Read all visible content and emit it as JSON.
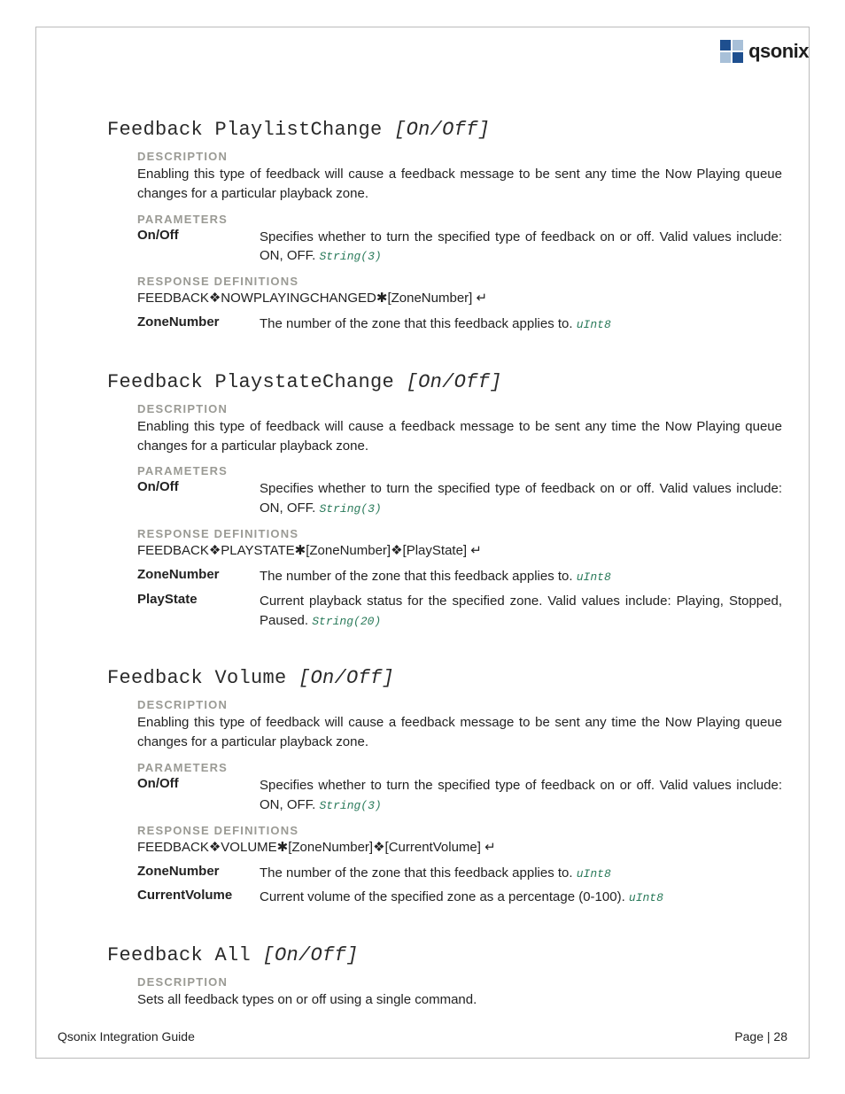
{
  "brand": "qsonix",
  "footer": {
    "left": "Qsonix Integration Guide",
    "right": "Page | 28"
  },
  "labels": {
    "description": "DESCRIPTION",
    "parameters": "PARAMETERS",
    "response_definitions": "RESPONSE DEFINITIONS"
  },
  "sections": [
    {
      "title_cmd": "Feedback PlaylistChange",
      "title_arg": "[On/Off]",
      "description": "Enabling this type of feedback will cause a feedback message to be sent any time the Now Playing queue changes for a particular playback zone.",
      "parameters": [
        {
          "name": "On/Off",
          "desc": "Specifies whether to turn the specified type of feedback on or off.  Valid values include:  ON, OFF.",
          "type": "String(3)"
        }
      ],
      "response": "FEEDBACK❖NOWPLAYINGCHANGED✱[ZoneNumber] ↵",
      "response_params": [
        {
          "name": "ZoneNumber",
          "desc": "The number of the zone that this feedback applies to.",
          "type": "uInt8"
        }
      ]
    },
    {
      "title_cmd": "Feedback PlaystateChange",
      "title_arg": "[On/Off]",
      "description": "Enabling this type of feedback will cause a feedback message to be sent any time the Now Playing queue changes for a particular playback zone.",
      "parameters": [
        {
          "name": "On/Off",
          "desc": "Specifies whether to turn the specified type of feedback on or off.  Valid values include:  ON, OFF.",
          "type": "String(3)"
        }
      ],
      "response": "FEEDBACK❖PLAYSTATE✱[ZoneNumber]❖[PlayState] ↵",
      "response_params": [
        {
          "name": "ZoneNumber",
          "desc": "The number of the zone that this feedback applies to.",
          "type": "uInt8"
        },
        {
          "name": "PlayState",
          "desc": "Current playback status for the specified zone.  Valid values include: Playing, Stopped, Paused.",
          "type": "String(20)"
        }
      ]
    },
    {
      "title_cmd": "Feedback Volume",
      "title_arg": "[On/Off]",
      "description": "Enabling this type of feedback will cause a feedback message to be sent any time the Now Playing queue changes for a particular playback zone.",
      "parameters": [
        {
          "name": "On/Off",
          "desc": "Specifies whether to turn the specified type of feedback on or off.  Valid values include:  ON, OFF.",
          "type": "String(3)"
        }
      ],
      "response": "FEEDBACK❖VOLUME✱[ZoneNumber]❖[CurrentVolume] ↵",
      "response_params": [
        {
          "name": "ZoneNumber",
          "desc": "The number of the zone that this feedback applies to.",
          "type": "uInt8"
        },
        {
          "name": "CurrentVolume",
          "desc": "Current volume of the specified zone as a percentage (0-100).",
          "type": "uInt8"
        }
      ]
    },
    {
      "title_cmd": "Feedback All",
      "title_arg": "[On/Off]",
      "description": "Sets all feedback types on or off using a single command.",
      "parameters": [],
      "response": null,
      "response_params": []
    }
  ]
}
